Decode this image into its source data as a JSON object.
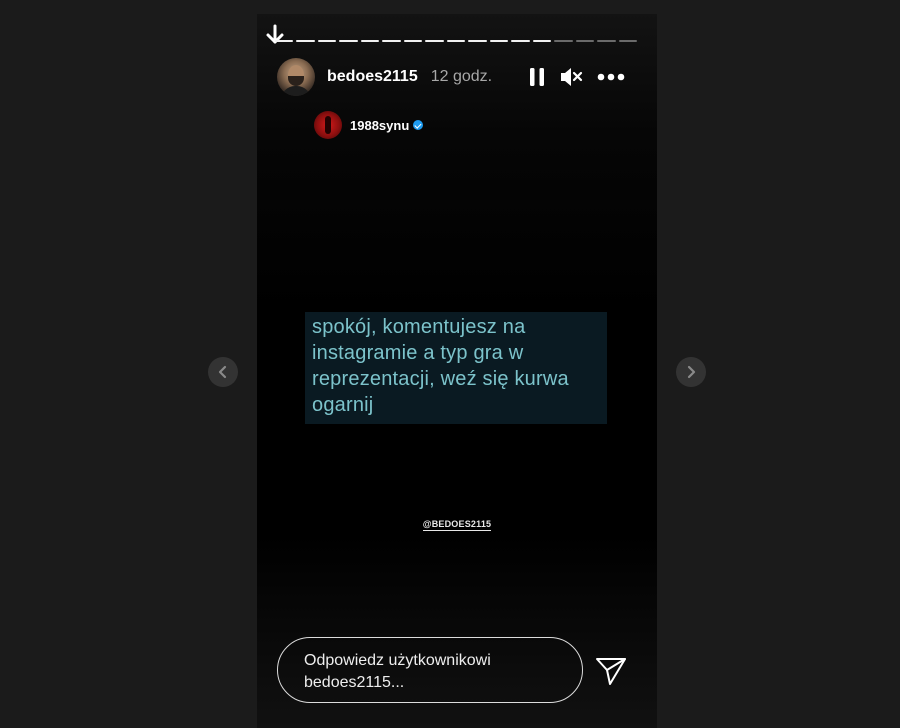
{
  "story": {
    "username": "bedoes2115",
    "time": "12 godz.",
    "progress_total": 17,
    "progress_done": 13,
    "repost": {
      "username": "1988synu",
      "verified": true
    },
    "quote_lines": [
      "spokój, komentujesz na",
      "instagramie a typ gra w",
      "reprezentacji, weź się kurwa",
      "ogarnij"
    ],
    "watermark": "@BEDOES2115",
    "reply_placeholder_line1": "Odpowiedz użytkownikowi",
    "reply_placeholder_line2": "bedoes2115..."
  },
  "icons": {
    "pause": "pause-icon",
    "mute": "speaker-muted-icon",
    "more": "more-options-icon",
    "send": "send-icon",
    "prev": "chevron-left-icon",
    "next": "chevron-right-icon"
  },
  "colors": {
    "page_bg": "#1b1b1b",
    "quote_text": "#7cc3cb",
    "quote_bg": "#0a1a22",
    "verified": "#1d9bf0"
  }
}
